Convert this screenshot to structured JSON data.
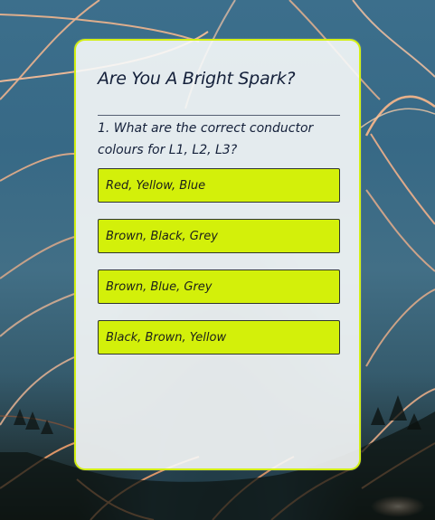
{
  "quiz": {
    "title": "Are You A Bright Spark?",
    "question": "1. What are the correct conductor colours for L1, L2, L3?",
    "answers": [
      {
        "label": "Red, Yellow, Blue"
      },
      {
        "label": "Brown, Black, Grey"
      },
      {
        "label": "Brown, Blue, Grey"
      },
      {
        "label": "Black, Brown, Yellow"
      }
    ]
  },
  "colors": {
    "accent": "#d3f00a",
    "card_background": "#f7fafa",
    "text": "#14203a"
  }
}
